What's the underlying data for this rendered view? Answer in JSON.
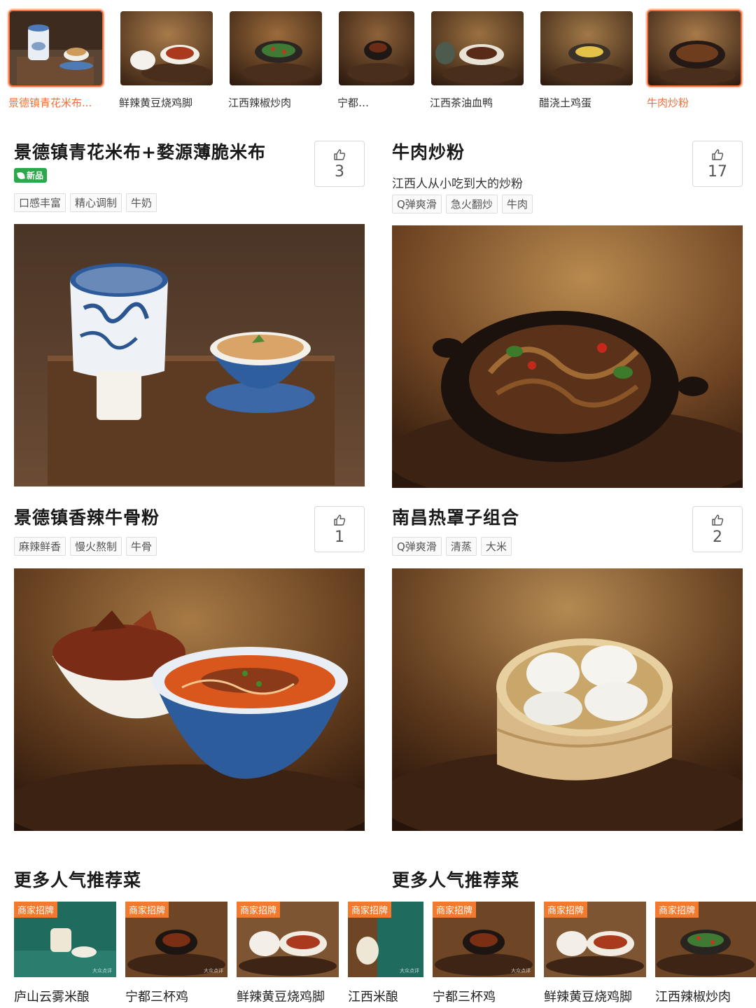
{
  "thumbnails": [
    {
      "label": "景德镇青花米布...",
      "active": true
    },
    {
      "label": "鲜辣黄豆烧鸡脚",
      "active": false
    },
    {
      "label": "江西辣椒炒肉",
      "active": false
    },
    {
      "label": "宁都三杯",
      "active": false
    },
    {
      "label": "江西茶油血鸭",
      "active": false
    },
    {
      "label": "醋浇土鸡蛋",
      "active": false
    },
    {
      "label": "牛肉炒粉",
      "active": true
    }
  ],
  "dishes": [
    {
      "title": "景德镇青花米布+婺源薄脆米布",
      "badge": "新品",
      "subtitle": "",
      "tags": [
        "口感丰富",
        "精心调制",
        "牛奶"
      ],
      "likes": "3"
    },
    {
      "title": "牛肉炒粉",
      "badge": "",
      "subtitle": "江西人从小吃到大的炒粉",
      "tags": [
        "Q弹爽滑",
        "急火翻炒",
        "牛肉"
      ],
      "likes": "17"
    },
    {
      "title": "景德镇香辣牛骨粉",
      "badge": "",
      "subtitle": "",
      "tags": [
        "麻辣鲜香",
        "慢火熬制",
        "牛骨"
      ],
      "likes": "1"
    },
    {
      "title": "南昌热罩子组合",
      "badge": "",
      "subtitle": "",
      "tags": [
        "Q弹爽滑",
        "清蒸",
        "大米"
      ],
      "likes": "2"
    }
  ],
  "more": {
    "left_title": "更多人气推荐菜",
    "right_title": "更多人气推荐菜",
    "flag": "商家招牌",
    "watermark": "大众点评",
    "items": [
      "庐山云雾米酿",
      "宁都三杯鸡",
      "鲜辣黄豆烧鸡脚",
      "江西米酿",
      "宁都三杯鸡",
      "鲜辣黄豆烧鸡脚",
      "江西辣椒炒肉"
    ]
  },
  "colors": {
    "accent": "#f36f3d",
    "badge_green": "#2aa84a",
    "flag_orange": "#f27a2f"
  },
  "icons": {
    "like": "thumbs-up-icon",
    "new": "leaf-icon"
  }
}
